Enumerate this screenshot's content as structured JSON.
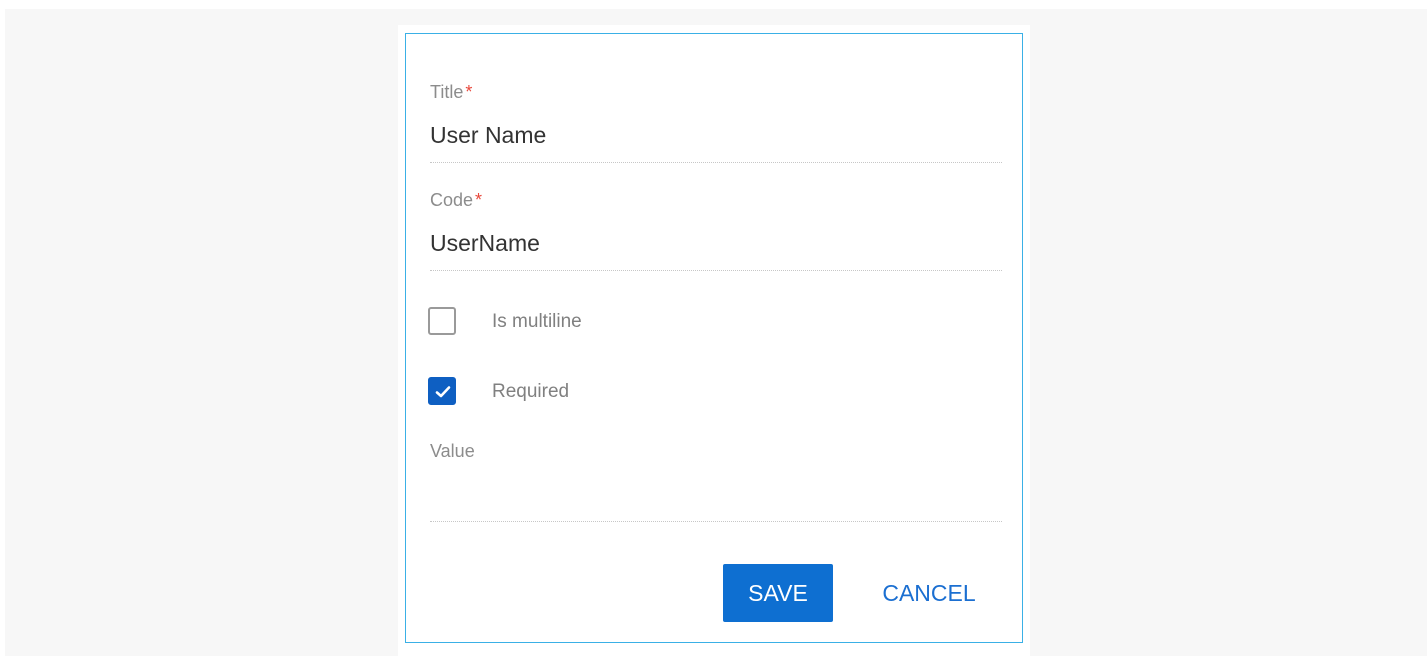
{
  "form": {
    "title_field": {
      "label": "Title",
      "required_mark": "*",
      "value": "User Name"
    },
    "code_field": {
      "label": "Code",
      "required_mark": "*",
      "value": "UserName"
    },
    "is_multiline": {
      "label": "Is multiline",
      "checked": false
    },
    "required": {
      "label": "Required",
      "checked": true
    },
    "value_field": {
      "label": "Value",
      "value": ""
    }
  },
  "actions": {
    "save_label": "SAVE",
    "cancel_label": "CANCEL"
  },
  "colors": {
    "dialog_border": "#3ab0e6",
    "primary": "#0e6fd1",
    "checkbox_checked": "#0e5fc2",
    "required_star": "#e8473b",
    "page_background": "#f7f7f7"
  },
  "icons": {
    "checkmark": "checkmark-icon"
  }
}
